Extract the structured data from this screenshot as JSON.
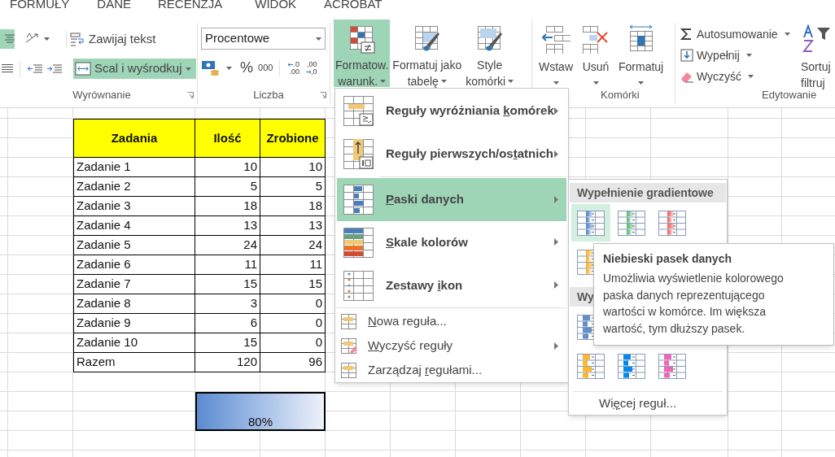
{
  "ribbon_tabs": [
    "FORMUŁY",
    "DANE",
    "RECENZJA",
    "WIDOK",
    "ACROBAT"
  ],
  "ribbon": {
    "alignment": {
      "label": "Wyrównanie",
      "align_center": {
        "selected": true
      },
      "wrap_text": {
        "label": "Zawijaj tekst",
        "selected": false
      },
      "merge": {
        "label": "Scal i wyśrodkuj",
        "selected": true
      }
    },
    "number": {
      "label": "Liczba",
      "format": "Procentowe",
      "percent": "%",
      "thousands": "000",
      "decimals": [
        {
          "top": ".0",
          "bottom": ".00"
        },
        {
          "top": ",00",
          "bottom": ",0"
        }
      ]
    },
    "styles": {
      "buttons": [
        {
          "lines": [
            "Formatow.",
            "warunk."
          ],
          "selected": true
        },
        {
          "lines": [
            "Formatuj jako",
            "tabelę"
          ],
          "selected": false
        },
        {
          "lines": [
            "Style",
            "komórki"
          ],
          "selected": false
        }
      ]
    },
    "cells": {
      "label": "Komórki",
      "buttons": [
        {
          "label": "Wstaw"
        },
        {
          "label": "Usuń"
        },
        {
          "label": "Formatuj"
        }
      ]
    },
    "editing": {
      "label": "Edytowanie",
      "items": [
        {
          "label": "Autosumowanie"
        },
        {
          "label": "Wypełnij"
        },
        {
          "label": "Wyczyść"
        }
      ],
      "sort": [
        "Sortuj",
        "filtruj"
      ]
    }
  },
  "sheet": {
    "columns": [
      "Zadania",
      "Ilość",
      "Zrobione"
    ],
    "rows": [
      {
        "task": "Zadanie 1",
        "count": "10",
        "done": "10"
      },
      {
        "task": "Zadanie 2",
        "count": "5",
        "done": "5"
      },
      {
        "task": "Zadanie 3",
        "count": "18",
        "done": "18"
      },
      {
        "task": "Zadanie 4",
        "count": "13",
        "done": "13"
      },
      {
        "task": "Zadanie 5",
        "count": "24",
        "done": "24"
      },
      {
        "task": "Zadanie 6",
        "count": "11",
        "done": "11"
      },
      {
        "task": "Zadanie 7",
        "count": "15",
        "done": "15"
      },
      {
        "task": "Zadanie 8",
        "count": "3",
        "done": "0"
      },
      {
        "task": "Zadanie 9",
        "count": "6",
        "done": "0"
      },
      {
        "task": "Zadanie 10",
        "count": "15",
        "done": "0"
      },
      {
        "task": "Razem",
        "count": "120",
        "done": "96"
      }
    ],
    "progress": {
      "reading": "80%"
    }
  },
  "menu": {
    "items": [
      {
        "kind": "large",
        "label": {
          "before": "Reguły wyróżniania ",
          "key": "k",
          "after": "omórek"
        },
        "submenu": true,
        "selected": false,
        "separator_before": false
      },
      {
        "kind": "large",
        "label": {
          "before": "Reguły pierwszych/os",
          "key": "t",
          "after": "atnich"
        },
        "submenu": true,
        "selected": false,
        "separator_before": false
      },
      {
        "kind": "large",
        "label": {
          "key": "P",
          "after": "aski danych"
        },
        "submenu": true,
        "selected": true,
        "separator_before": true
      },
      {
        "kind": "large",
        "label": {
          "key": "S",
          "after": "kale kolorów"
        },
        "submenu": true,
        "selected": false,
        "separator_before": false
      },
      {
        "kind": "large",
        "label": {
          "before": "Zestawy ",
          "key": "i",
          "after": "kon"
        },
        "submenu": true,
        "selected": false,
        "separator_before": false
      },
      {
        "kind": "small",
        "label": {
          "key": "N",
          "after": "owa reguła..."
        },
        "submenu": false,
        "selected": false,
        "separator_before": true
      },
      {
        "kind": "small",
        "label": {
          "key": "W",
          "after": "yczyść reguły"
        },
        "submenu": true,
        "selected": false,
        "separator_before": false
      },
      {
        "kind": "small",
        "label": {
          "before": "Zarządzaj ",
          "key": "r",
          "after": "egułami..."
        },
        "submenu": false,
        "selected": false,
        "separator_before": false
      }
    ]
  },
  "submenu": {
    "sections": [
      {
        "title": "Wypełnienie gradientowe",
        "kind": "gradient",
        "rows": [
          [
            {
              "color": "#5b8bd0",
              "selected": true
            },
            {
              "color": "#63be7b",
              "selected": false
            },
            {
              "color": "#f8696b",
              "selected": false
            }
          ],
          [
            {
              "color": "#ffb628",
              "selected": false
            }
          ]
        ]
      },
      {
        "title": "Wy",
        "kind": "solid",
        "rows": [
          [
            {
              "color": "#638ec6",
              "selected": false
            }
          ],
          [
            {
              "color": "#ffb628",
              "selected": false
            },
            {
              "color": "#008aef",
              "selected": false
            },
            {
              "color": "#f066b4",
              "selected": false
            }
          ]
        ]
      }
    ],
    "more": {
      "before": "Wi",
      "key": "ę",
      "after": "cej reguł..."
    }
  },
  "tooltip": {
    "title": "Niebieski pasek danych",
    "text": "Umożliwia wyświetlenie kolorowego paska danych reprezentującego wartości w komórce. Im większa wartość, tym dłuższy pasek."
  }
}
